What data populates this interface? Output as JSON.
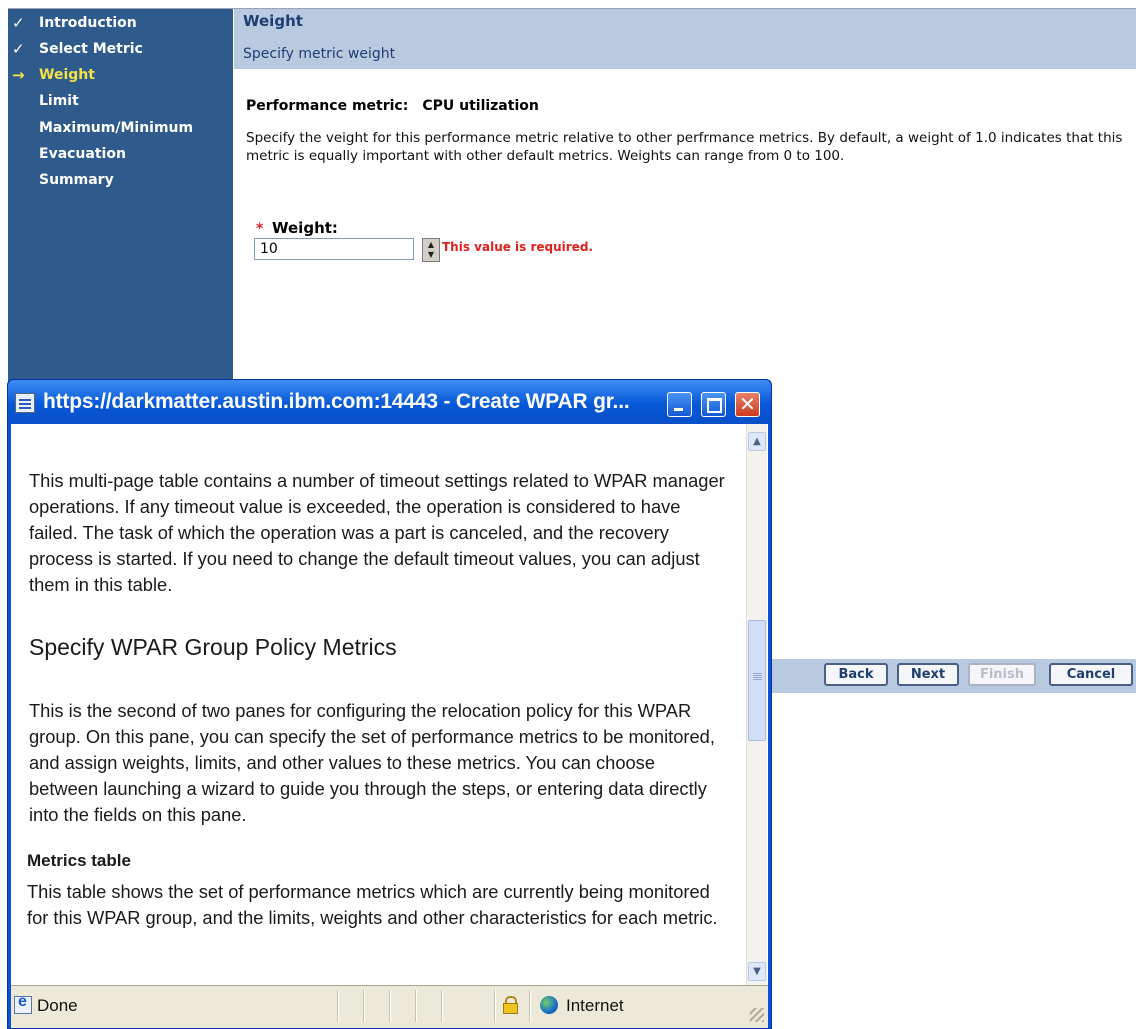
{
  "wizard": {
    "nav": [
      {
        "label": "Introduction",
        "mark": "✓",
        "state": "done"
      },
      {
        "label": "Select Metric",
        "mark": "✓",
        "state": "done"
      },
      {
        "label": "Weight",
        "mark": "→",
        "state": "current"
      },
      {
        "label": "Limit",
        "mark": "",
        "state": "todo"
      },
      {
        "label": "Maximum/Minimum",
        "mark": "",
        "state": "todo"
      },
      {
        "label": "Evacuation",
        "mark": "",
        "state": "todo"
      },
      {
        "label": "Summary",
        "mark": "",
        "state": "todo"
      }
    ],
    "title": "Weight",
    "subtitle": "Specify metric weight",
    "performance_metric_label": "Performance metric:",
    "performance_metric_value": "CPU utilization",
    "description": "Specify the veight for this performance metric relative to other perfrmance metrics. By default, a weight of 1.0 indicates that this metric is equally important with other default metrics. Weights can range from 0 to 100.",
    "required_marker": "*",
    "weight_label": "Weight:",
    "weight_value": "10",
    "error_message": "This value is required.",
    "buttons": {
      "back": "Back",
      "next": "Next",
      "finish": "Finish",
      "cancel": "Cancel"
    },
    "colors": {
      "nav_bg": "#2e5a8c",
      "header_bg": "#b9c9e0",
      "current_step": "#f5e24a",
      "error": "#e0201c"
    }
  },
  "popup": {
    "title": "https://darkmatter.austin.ibm.com:14443 - Create WPAR gr...",
    "paragraph1": "This multi-page table contains a number of timeout settings related to WPAR manager operations. If any timeout value is exceeded, the operation is considered to have failed.  The task of which the operation was a part is canceled, and the recovery process is started. If you need to change the default timeout values, you can adjust them in this table.",
    "heading": "Specify WPAR Group Policy Metrics",
    "paragraph2": "This is the second of two panes for configuring the relocation policy for this WPAR group.  On this pane, you can specify the set of performance metrics to be monitored, and assign weights, limits, and other values to these metrics. You can choose between launching a wizard to guide you through the steps, or entering data directly into the fields on this pane.",
    "subheading": "Metrics table",
    "paragraph3": "This table shows the set of performance metrics which are currently being monitored for this WPAR group, and the limits, weights and other characteristics for each metric.",
    "status_text": "Done",
    "zone_text": "Internet",
    "colors": {
      "titlebar": "#0658d8",
      "close_button": "#cc3a1c",
      "statusbar": "#ece9d8"
    }
  }
}
